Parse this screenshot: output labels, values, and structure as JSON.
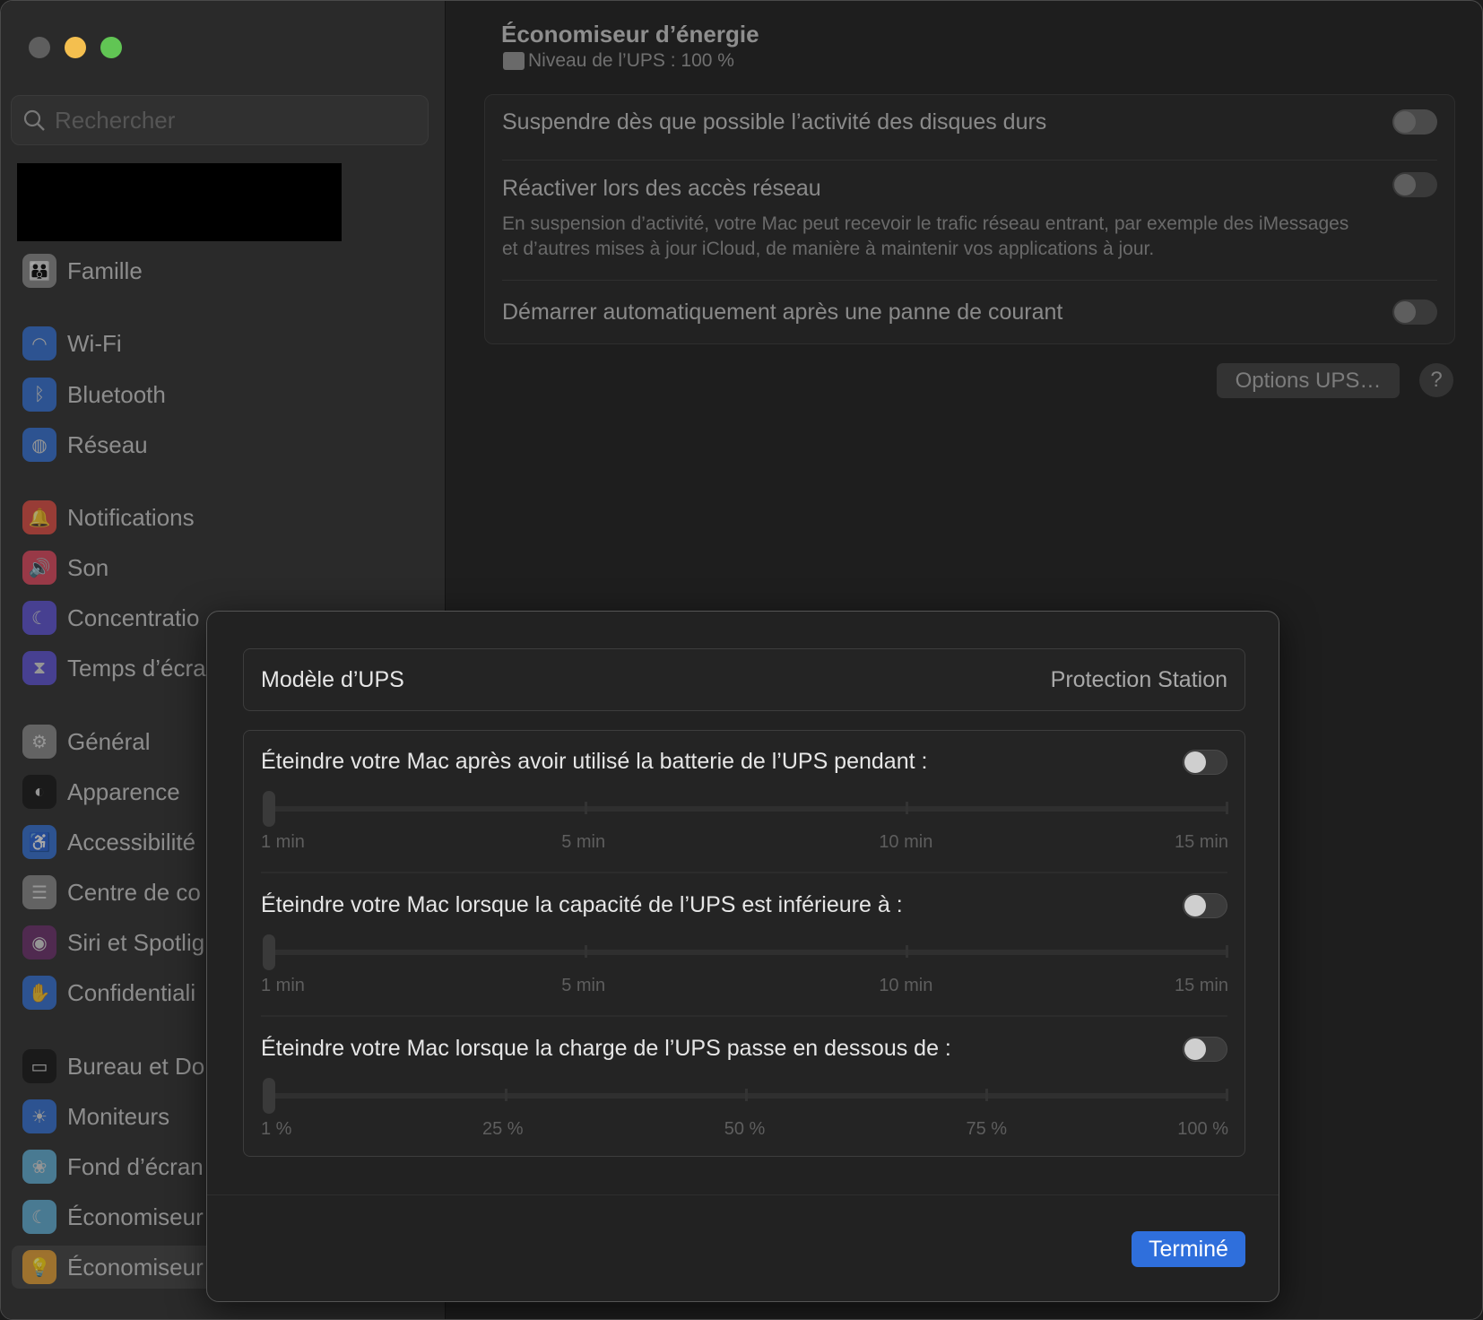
{
  "window": {
    "controls": {
      "close": "#5e5e5e",
      "minimize": "#f4bf4f",
      "zoom": "#61c554"
    }
  },
  "sidebar": {
    "search_placeholder": "Rechercher",
    "items": [
      {
        "label": "Famille",
        "icon": "family-icon",
        "color": "#8a8a8a"
      },
      {
        "label": "Wi-Fi",
        "icon": "wifi-icon",
        "color": "#2f6fd6"
      },
      {
        "label": "Bluetooth",
        "icon": "bluetooth-icon",
        "color": "#2f6fd6"
      },
      {
        "label": "Réseau",
        "icon": "globe-icon",
        "color": "#2f6fd6"
      },
      {
        "label": "Notifications",
        "icon": "bell-icon",
        "color": "#e2483f"
      },
      {
        "label": "Son",
        "icon": "speaker-icon",
        "color": "#e2445b"
      },
      {
        "label": "Concentratio",
        "icon": "moon-icon",
        "color": "#5b4fd6"
      },
      {
        "label": "Temps d’écra",
        "icon": "hourglass-icon",
        "color": "#5b4fd6"
      },
      {
        "label": "Général",
        "icon": "gear-icon",
        "color": "#8a8a8a"
      },
      {
        "label": "Apparence",
        "icon": "appearance-icon",
        "color": "#111111"
      },
      {
        "label": "Accessibilité",
        "icon": "accessibility-icon",
        "color": "#2f6fd6"
      },
      {
        "label": "Centre de co",
        "icon": "control-center-icon",
        "color": "#8a8a8a"
      },
      {
        "label": "Siri et Spotlig",
        "icon": "siri-icon",
        "color": "#6a2a6a"
      },
      {
        "label": "Confidentiali",
        "icon": "hand-icon",
        "color": "#2f6fd6"
      },
      {
        "label": "Bureau et Do",
        "icon": "dock-icon",
        "color": "#111111"
      },
      {
        "label": "Moniteurs",
        "icon": "sun-icon",
        "color": "#2f6fd6"
      },
      {
        "label": "Fond d’écran",
        "icon": "flower-icon",
        "color": "#5fb0d8"
      },
      {
        "label": "Économiseur",
        "icon": "screensaver-icon",
        "color": "#5fb0d8"
      },
      {
        "label": "Économiseur",
        "icon": "lightbulb-icon",
        "color": "#e39a2a",
        "selected": true
      }
    ]
  },
  "main": {
    "title": "Économiseur d’énergie",
    "subtitle": "Niveau de l’UPS : 100 %",
    "rows": [
      {
        "label": "Suspendre dès que possible l’activité des disques durs",
        "on": true
      },
      {
        "label": "Réactiver lors des accès réseau",
        "description": "En suspension d’activité, votre Mac peut recevoir le trafic réseau entrant, par exemple des iMessages et d’autres mises à jour iCloud, de manière à maintenir vos applications à jour.",
        "on": false
      },
      {
        "label": "Démarrer automatiquement après une panne de courant",
        "on": false
      }
    ],
    "options_button": "Options UPS…",
    "help_button": "?"
  },
  "sheet": {
    "model_label": "Modèle d’UPS",
    "model_value": "Protection Station",
    "options": [
      {
        "label": "Éteindre votre Mac après avoir utilisé la batterie de l’UPS pendant :",
        "on": false,
        "value": "1 min",
        "ticks": [
          "1 min",
          "5 min",
          "10 min",
          "15 min"
        ]
      },
      {
        "label": "Éteindre votre Mac lorsque la capacité de l’UPS est inférieure à :",
        "on": false,
        "value": "1 min",
        "ticks": [
          "1 min",
          "5 min",
          "10 min",
          "15 min"
        ]
      },
      {
        "label": "Éteindre votre Mac lorsque la charge de l’UPS passe en dessous de :",
        "on": false,
        "value": "1 %",
        "ticks": [
          "1 %",
          "25 %",
          "50 %",
          "75 %",
          "100 %"
        ]
      }
    ],
    "done_button": "Terminé",
    "accent": "#2f6fdc"
  }
}
